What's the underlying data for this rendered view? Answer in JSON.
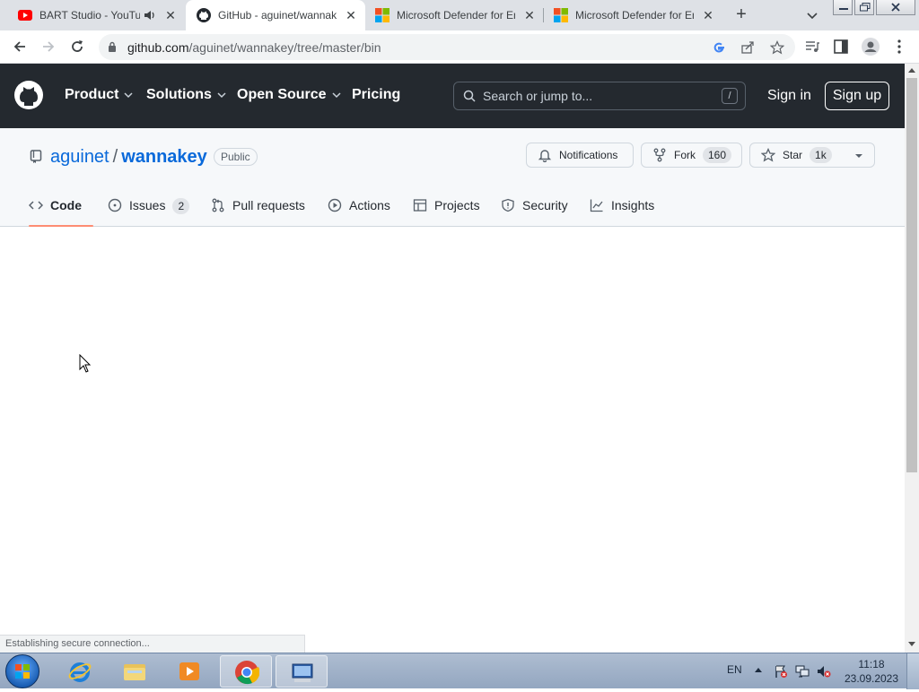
{
  "browser": {
    "tabs": [
      {
        "title": "BART Studio - YouTube",
        "icon": "youtube-icon",
        "audio": true
      },
      {
        "title": "GitHub - aguinet/wannakey",
        "icon": "github-icon",
        "active": true
      },
      {
        "title": "Microsoft Defender for Endpoint",
        "icon": "microsoft-icon"
      },
      {
        "title": "Microsoft Defender for Endpoint",
        "icon": "microsoft-icon"
      }
    ],
    "url_host": "github.com",
    "url_path": "/aguinet/wannakey/tree/master/bin",
    "status_text": "Establishing secure connection..."
  },
  "github": {
    "nav": [
      "Product",
      "Solutions",
      "Open Source",
      "Pricing"
    ],
    "search_placeholder": "Search or jump to...",
    "search_shortcut": "/",
    "sign_in": "Sign in",
    "sign_up": "Sign up"
  },
  "repo": {
    "owner": "aguinet",
    "separator": "/",
    "name": "wannakey",
    "visibility": "Public",
    "notifications_label": "Notifications",
    "fork_label": "Fork",
    "fork_count": "160",
    "star_label": "Star",
    "star_count": "1k",
    "tabs": [
      {
        "label": "Code",
        "selected": true
      },
      {
        "label": "Issues",
        "count": "2"
      },
      {
        "label": "Pull requests"
      },
      {
        "label": "Actions"
      },
      {
        "label": "Projects"
      },
      {
        "label": "Security"
      },
      {
        "label": "Insights"
      }
    ]
  },
  "taskbar": {
    "apps": [
      "internet-explorer-icon",
      "file-explorer-icon",
      "media-player-icon",
      "chrome-icon",
      "remote-desktop-icon"
    ],
    "language": "EN",
    "time": "11:18",
    "date": "23.09.2023"
  },
  "colors": {
    "github_header": "#24292f",
    "link": "#0969da",
    "tab_underline": "#fd8c73",
    "repo_header_bg": "#f6f8fa"
  }
}
